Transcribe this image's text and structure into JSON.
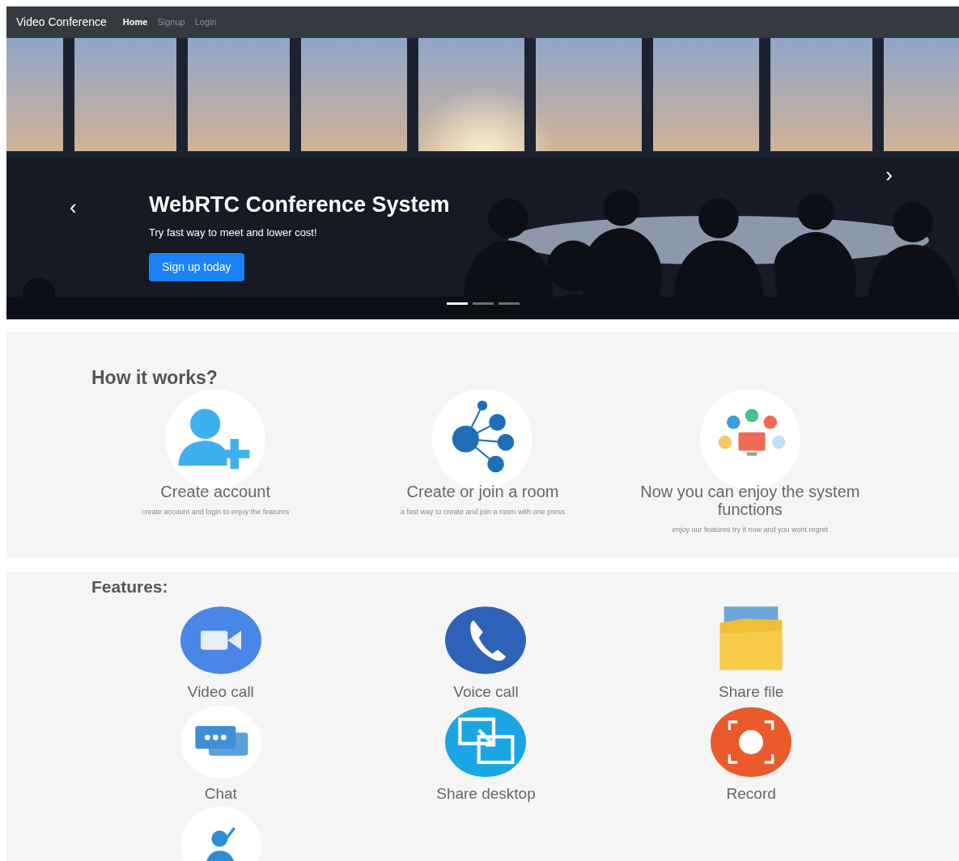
{
  "navbar": {
    "brand": "Video Conference",
    "links": [
      {
        "label": "Home",
        "selected": true
      },
      {
        "label": "Signup",
        "selected": false
      },
      {
        "label": "Login",
        "selected": false
      }
    ]
  },
  "hero": {
    "title": "WebRTC Conference System",
    "subtitle": "Try fast way to meet and lower cost!",
    "button": "Sign up today",
    "prev": "‹",
    "next": "›",
    "indicators": [
      {
        "selected": true
      },
      {
        "selected": false
      },
      {
        "selected": false
      }
    ]
  },
  "how_it_works": {
    "heading": "How it works?",
    "steps": [
      {
        "kind": "account",
        "title": "Create account",
        "text": "create account and login to enjoy the features"
      },
      {
        "kind": "room",
        "title": "Create or join a room",
        "text": "a fast way to create and join a room with one press"
      },
      {
        "kind": "functions",
        "title": "Now you can enjoy the system functions",
        "text": "enjoy our features try it now and you wont regret"
      }
    ]
  },
  "features": {
    "heading": "Features:",
    "items": [
      {
        "kind": "video",
        "label": "Video call"
      },
      {
        "kind": "voice",
        "label": "Voice call"
      },
      {
        "kind": "file",
        "label": "Share file"
      },
      {
        "kind": "chat",
        "label": "Chat"
      },
      {
        "kind": "desktop",
        "label": "Share desktop"
      },
      {
        "kind": "record",
        "label": "Record"
      },
      {
        "kind": "user"
      }
    ]
  }
}
